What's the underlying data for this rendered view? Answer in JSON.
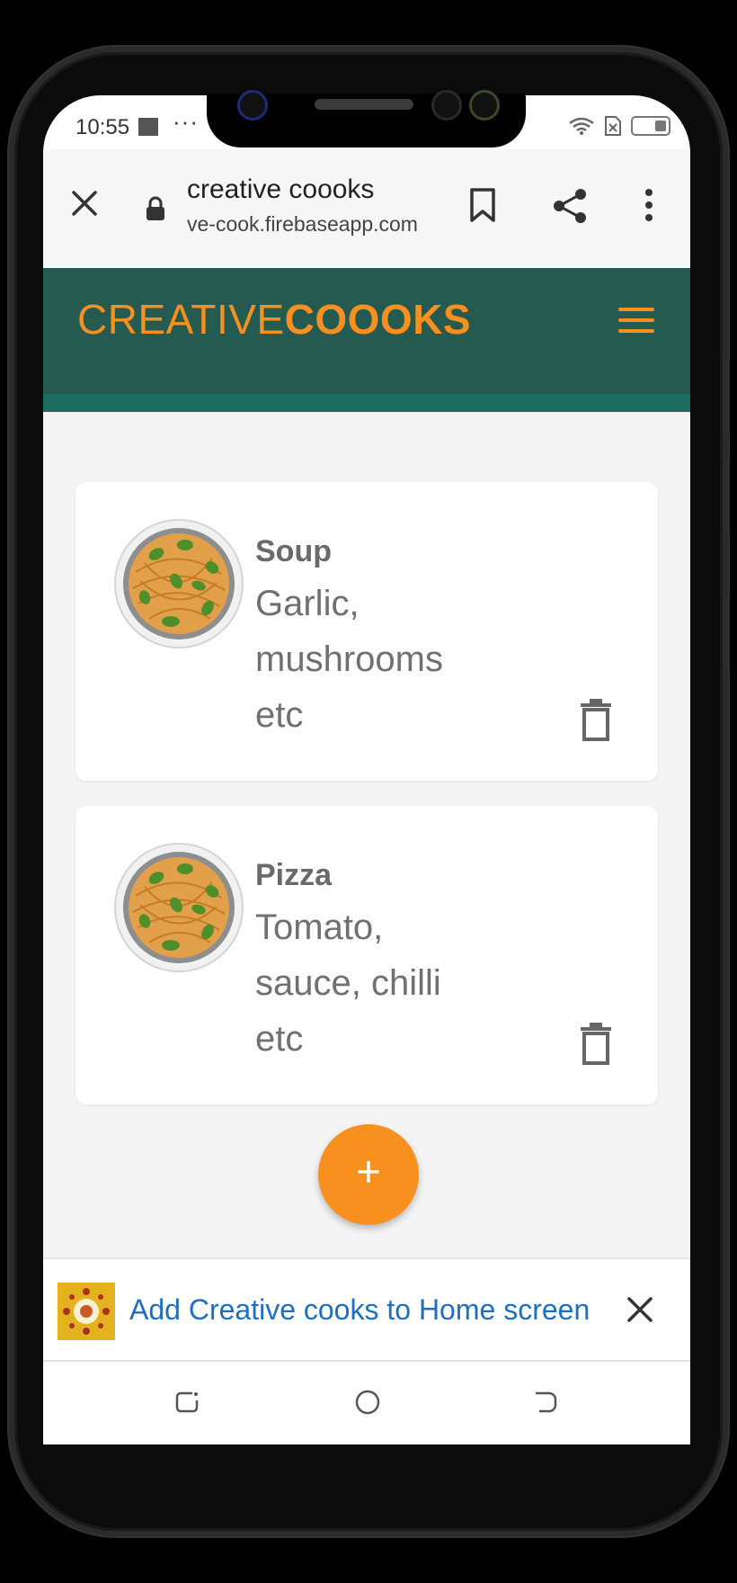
{
  "status_bar": {
    "time": "10:55",
    "more": "···"
  },
  "browser": {
    "page_title": "creative coooks",
    "url": "ve-cook.firebaseapp.com"
  },
  "header": {
    "logo_light": "CREATIVE",
    "logo_bold": "COOOKS"
  },
  "recipes": [
    {
      "title": "Soup",
      "description": "Garlic, mushrooms etc"
    },
    {
      "title": "Pizza",
      "description": "Tomato, sauce, chilli etc"
    }
  ],
  "fab": {
    "label": "+"
  },
  "banner": {
    "text": "Add Creative cooks to Home screen"
  },
  "colors": {
    "header_bg": "#245a50",
    "accent": "#f7901e",
    "link": "#1d6fc4"
  }
}
